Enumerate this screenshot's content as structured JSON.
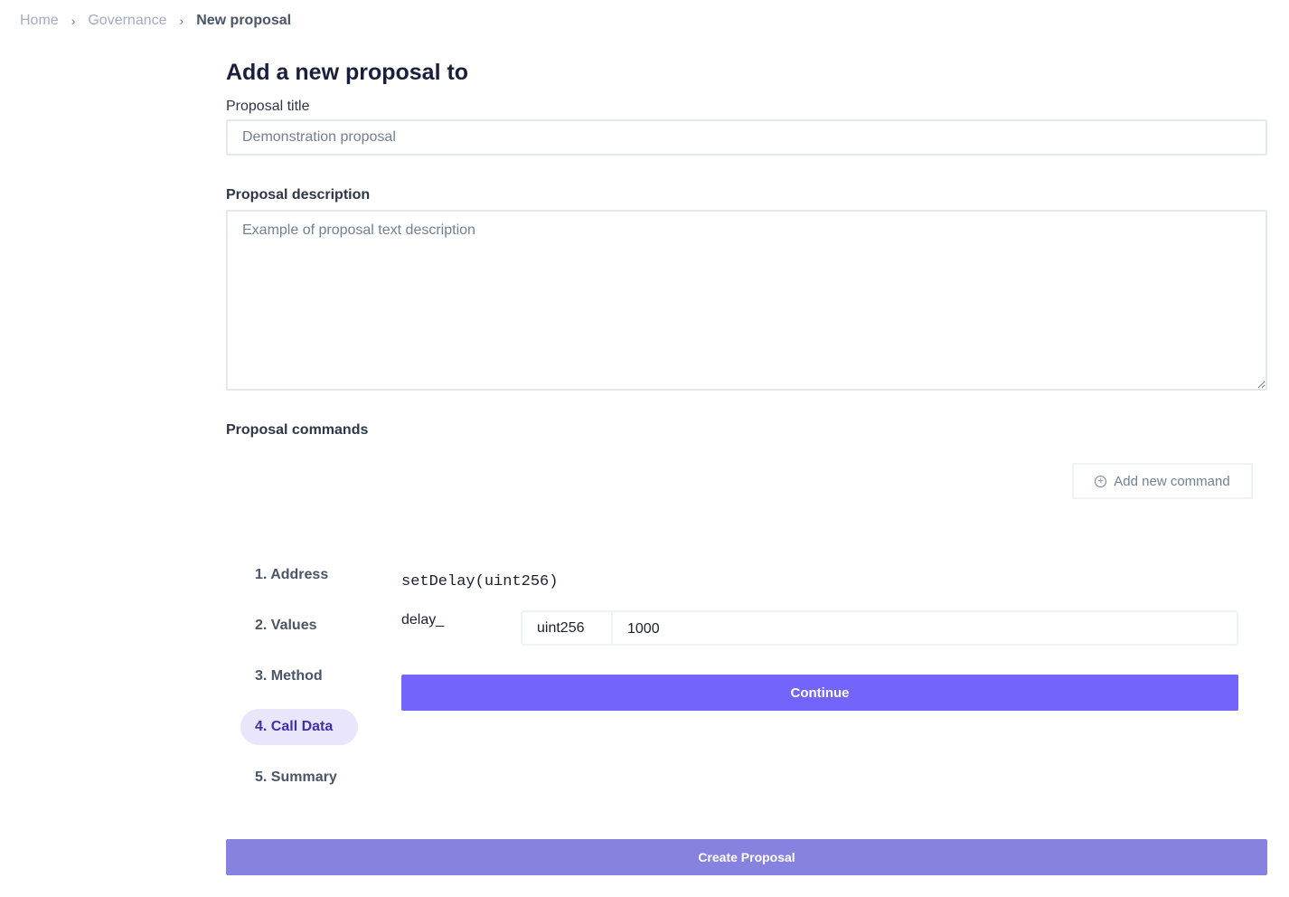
{
  "breadcrumb": {
    "items": [
      "Home",
      "Governance"
    ],
    "current": "New proposal"
  },
  "page_title": "Add a new proposal to",
  "form": {
    "title_label": "Proposal title",
    "title_value": "Demonstration proposal",
    "description_label": "Proposal description",
    "description_value": "Example of proposal text description",
    "commands_label": "Proposal commands",
    "add_command_label": "Add new command"
  },
  "steps": [
    "1. Address",
    "2. Values",
    "3. Method",
    "4. Call Data",
    "5. Summary"
  ],
  "active_step": "4. Call Data",
  "call_data": {
    "signature": "setDelay(uint256)",
    "param_name": "delay_",
    "param_type": "uint256",
    "param_value": "1000",
    "continue_label": "Continue"
  },
  "create_label": "Create Proposal"
}
